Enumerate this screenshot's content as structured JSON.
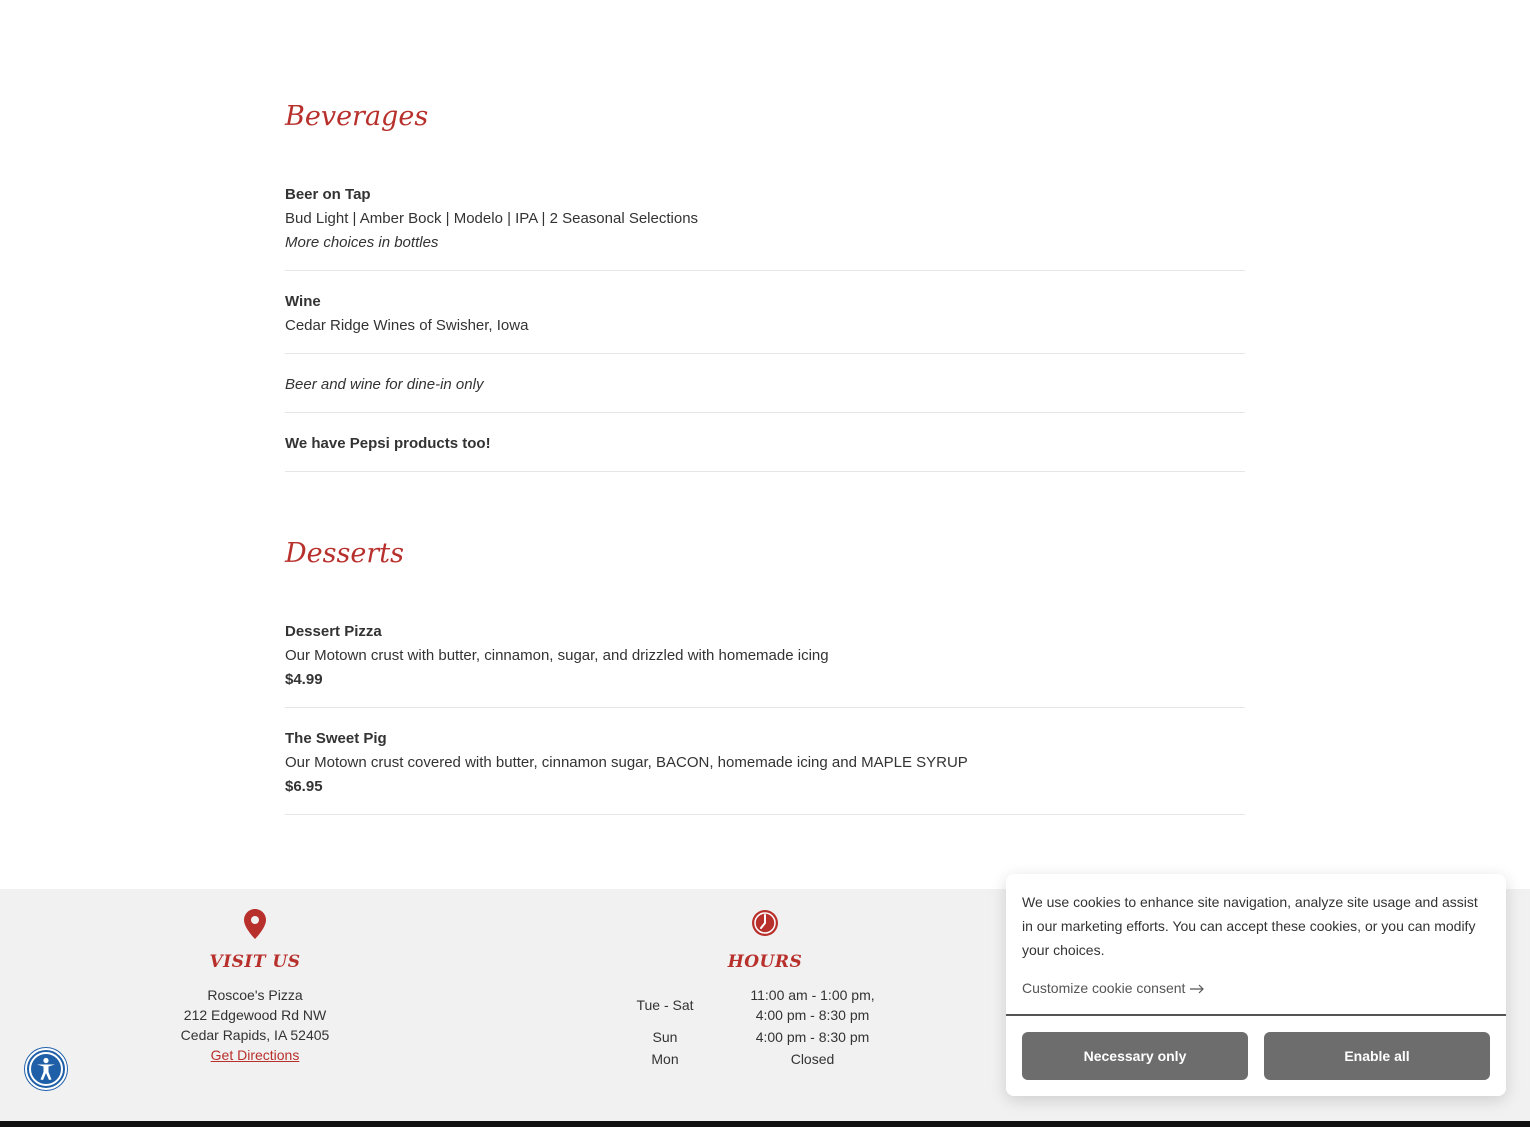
{
  "beverages": {
    "title": "Beverages",
    "items": [
      {
        "name": "Beer on Tap",
        "desc": "Bud Light | Amber Bock | Modelo | IPA | 2 Seasonal Selections",
        "note": "More choices in bottles"
      },
      {
        "name": "Wine",
        "desc": "Cedar Ridge Wines of Swisher, Iowa"
      },
      {
        "note": "Beer and wine for dine-in only"
      },
      {
        "name": "We have Pepsi products too!"
      }
    ]
  },
  "desserts": {
    "title": "Desserts",
    "items": [
      {
        "name": "Dessert Pizza",
        "desc": "Our Motown crust with butter, cinnamon, sugar, and drizzled with homemade icing",
        "price": "$4.99"
      },
      {
        "name": "The Sweet Pig",
        "desc": "Our Motown crust covered with butter, cinnamon sugar, BACON, homemade icing and MAPLE SYRUP",
        "price": "$6.95"
      }
    ]
  },
  "footer": {
    "visit": {
      "title": "VISIT US",
      "name": "Roscoe's Pizza",
      "street": "212 Edgewood Rd NW",
      "city": "Cedar Rapids, IA 52405",
      "directions_label": "Get Directions"
    },
    "hours": {
      "title": "HOURS",
      "rows": [
        {
          "day": "Tue - Sat",
          "time1": "11:00 am - 1:00 pm,",
          "time2": "4:00 pm - 8:30 pm"
        },
        {
          "day": "Sun",
          "time1": "4:00 pm - 8:30 pm"
        },
        {
          "day": "Mon",
          "time1": "Closed"
        }
      ]
    }
  },
  "cookie": {
    "text": "We use cookies to enhance site navigation, analyze site usage and assist in our marketing efforts. You can accept these cookies, or you can modify your choices.",
    "customize_label": "Customize cookie consent",
    "necessary_label": "Necessary only",
    "enable_label": "Enable all"
  },
  "colors": {
    "accent": "#b8302c",
    "footer_bg": "#f1f1f1",
    "button_bg": "#6d6d6d",
    "a11y_blue": "#1f5fa8"
  },
  "icons": {
    "location": "map-pin-icon",
    "hours": "clock-icon",
    "accessibility": "accessibility-icon",
    "arrow": "arrow-right-icon"
  }
}
